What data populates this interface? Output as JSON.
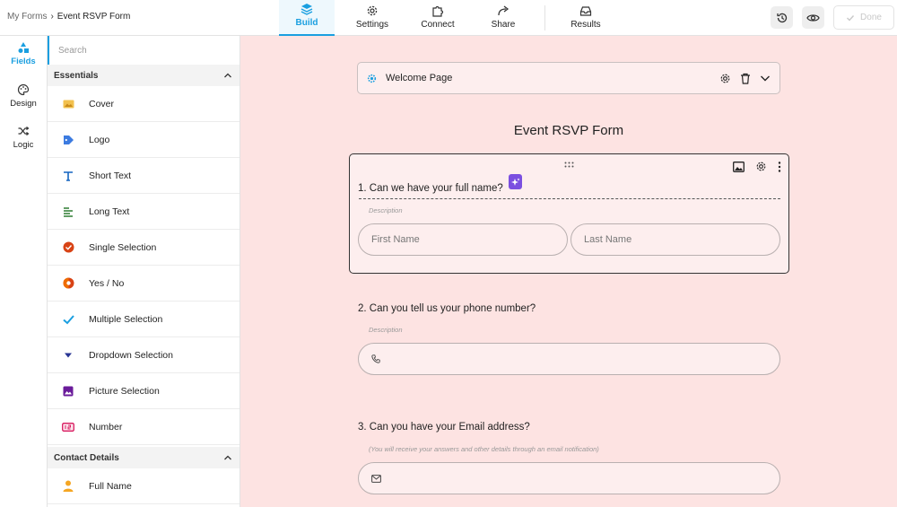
{
  "breadcrumb": {
    "root": "My Forms",
    "separator": "›",
    "current": "Event RSVP Form"
  },
  "nav": {
    "build": "Build",
    "settings": "Settings",
    "connect": "Connect",
    "share": "Share",
    "results": "Results"
  },
  "toolbar": {
    "done_label": "Done"
  },
  "rail": {
    "fields": "Fields",
    "design": "Design",
    "logic": "Logic"
  },
  "panel": {
    "search_placeholder": "Search",
    "essentials_title": "Essentials",
    "essentials": [
      {
        "label": "Cover",
        "icon": "image-icon"
      },
      {
        "label": "Logo",
        "icon": "tag-icon"
      },
      {
        "label": "Short Text",
        "icon": "text-t-icon"
      },
      {
        "label": "Long Text",
        "icon": "paragraph-icon"
      },
      {
        "label": "Single Selection",
        "icon": "radio-check-icon"
      },
      {
        "label": "Yes / No",
        "icon": "yes-no-icon"
      },
      {
        "label": "Multiple Selection",
        "icon": "checkmark-icon"
      },
      {
        "label": "Dropdown Selection",
        "icon": "caret-down-icon"
      },
      {
        "label": "Picture Selection",
        "icon": "picture-icon"
      },
      {
        "label": "Number",
        "icon": "number-icon"
      }
    ],
    "contact_title": "Contact Details",
    "contact": [
      {
        "label": "Full Name",
        "icon": "person-icon"
      }
    ]
  },
  "canvas": {
    "welcome_label": "Welcome Page",
    "form_title": "Event RSVP Form",
    "questions": [
      {
        "text": "1. Can we have your full name?",
        "description": "Description",
        "first_placeholder": "First Name",
        "last_placeholder": "Last Name"
      },
      {
        "text": "2. Can you tell us your phone number?",
        "description": "Description"
      },
      {
        "text": "3. Can you have your Email address?",
        "description": "(You will receive your answers and other details through an email notification)"
      }
    ]
  },
  "colors": {
    "accent": "#1a9fe0",
    "canvas_bg": "#fde3e2",
    "ai_badge": "#7b4fe0"
  }
}
